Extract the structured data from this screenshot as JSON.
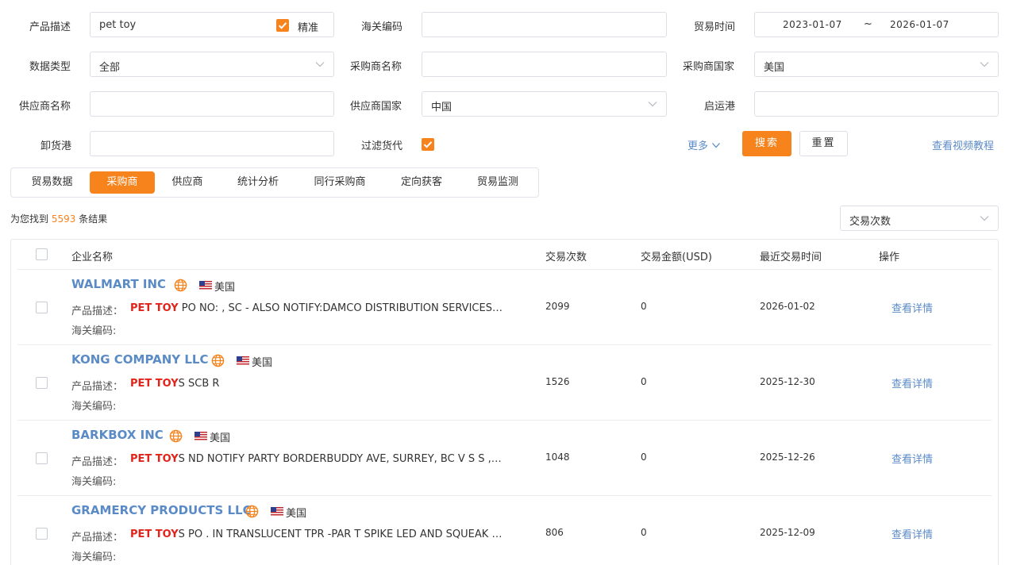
{
  "filters": {
    "product_desc_label": "产品描述",
    "product_desc_value": "pet toy",
    "exact_label": "精准",
    "hs_code_label": "海关编码",
    "trade_time_label": "贸易时间",
    "date_start": "2023-01-07",
    "date_sep": "~",
    "date_end": "2026-01-07",
    "data_type_label": "数据类型",
    "data_type_value": "全部",
    "buyer_name_label": "采购商名称",
    "buyer_country_label": "采购商国家",
    "buyer_country_value": "美国",
    "supplier_name_label": "供应商名称",
    "supplier_country_label": "供应商国家",
    "supplier_country_value": "中国",
    "origin_port_label": "启运港",
    "dest_port_label": "卸货港",
    "filter_forwarder_label": "过滤货代",
    "more_label": "更多",
    "search_label": "搜索",
    "reset_label": "重置",
    "video_tutorial_label": "查看视频教程"
  },
  "tabs": [
    {
      "label": "贸易数据",
      "active": false
    },
    {
      "label": "采购商",
      "active": true
    },
    {
      "label": "供应商",
      "active": false
    },
    {
      "label": "统计分析",
      "active": false
    },
    {
      "label": "同行采购商",
      "active": false
    },
    {
      "label": "定向获客",
      "active": false
    },
    {
      "label": "贸易监测",
      "active": false
    }
  ],
  "results": {
    "prefix": "为您找到",
    "count": "5593",
    "suffix": "条结果",
    "sort_value": "交易次数"
  },
  "table": {
    "headers": {
      "company": "企业名称",
      "trade_count": "交易次数",
      "trade_amount": "交易金额(USD)",
      "last_trade": "最近交易时间",
      "action": "操作"
    },
    "product_desc_label": "产品描述：",
    "hs_code_label": "海关编码:",
    "rows": [
      {
        "name": "WALMART INC",
        "country": "美国",
        "desc_hl": "PET TOY",
        "desc_rest": " PO NO: , SC - ALSO NOTIFY:DAMCO DISTRIBUTION SERVICES I...",
        "trade_count": "2099",
        "amount": "0",
        "last_date": "2026-01-02",
        "action": "查看详情"
      },
      {
        "name": "KONG COMPANY LLC",
        "country": "美国",
        "desc_hl": "PET TOY",
        "desc_rest": "S SCB R",
        "trade_count": "1526",
        "amount": "0",
        "last_date": "2025-12-30",
        "action": "查看详情"
      },
      {
        "name": "BARKBOX INC",
        "country": "美国",
        "desc_hl": "PET TOY",
        "desc_rest": "S ND NOTIFY PARTY BORDERBUDDY AVE, SURREY, BC V S S , CA...",
        "trade_count": "1048",
        "amount": "0",
        "last_date": "2025-12-26",
        "action": "查看详情"
      },
      {
        "name": "GRAMERCY PRODUCTS LLC",
        "country": "美国",
        "desc_hl": "PET TOY",
        "desc_rest": "S PO . IN TRANSLUCENT TPR -PAR T SPIKE LED AND SQUEAK BA...",
        "trade_count": "806",
        "amount": "0",
        "last_date": "2025-12-09",
        "action": "查看详情"
      }
    ]
  },
  "colors": {
    "accent": "#f7831d",
    "link": "#5b8bc7",
    "highlight": "#e2231a"
  }
}
